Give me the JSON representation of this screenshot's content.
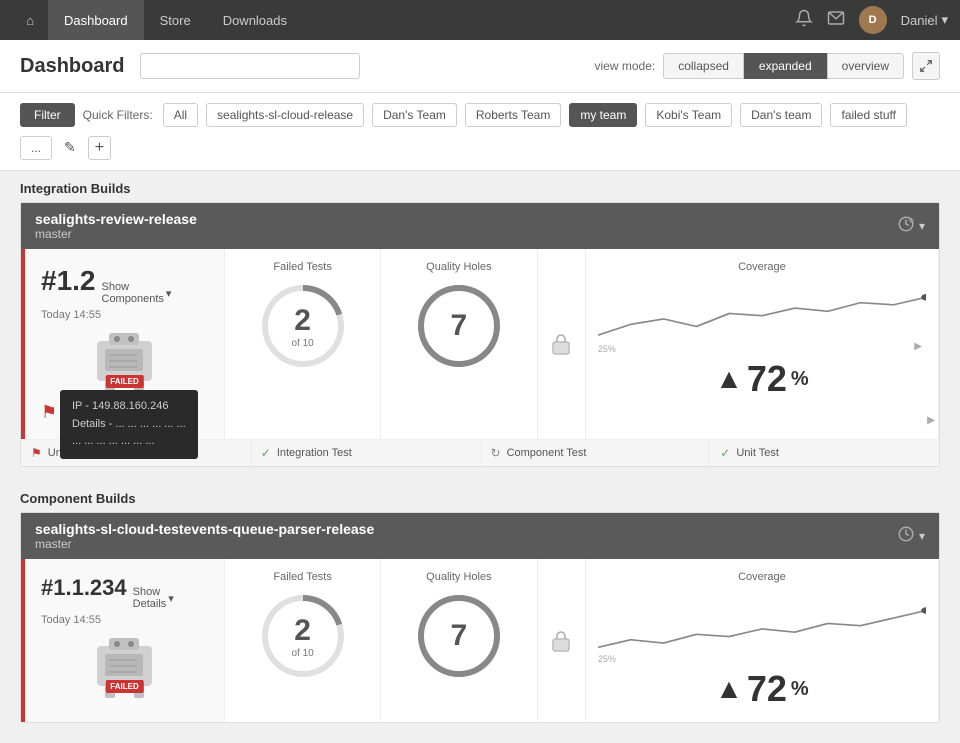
{
  "nav": {
    "home_icon": "⌂",
    "items": [
      {
        "label": "Dashboard",
        "active": true
      },
      {
        "label": "Store",
        "active": false
      },
      {
        "label": "Downloads",
        "active": false
      }
    ],
    "notification_icon": "🔔",
    "mail_icon": "✉",
    "user_name": "Daniel",
    "dropdown_icon": "▾"
  },
  "header": {
    "title": "Dashboard",
    "search_placeholder": "",
    "view_mode_label": "view mode:",
    "view_buttons": [
      "collapsed",
      "expanded",
      "overview"
    ],
    "active_view": "expanded",
    "expand_icon": "⤢"
  },
  "filter_bar": {
    "filter_btn": "Filter",
    "quick_filters_label": "Quick Filters:",
    "tags": [
      {
        "label": "All",
        "active": false
      },
      {
        "label": "sealights-sl-cloud-release",
        "active": false
      },
      {
        "label": "Dan's Team",
        "active": false
      },
      {
        "label": "Roberts Team",
        "active": false
      },
      {
        "label": "my team",
        "active": true
      },
      {
        "label": "Kobi's Team",
        "active": false
      },
      {
        "label": "Dan's team",
        "active": false
      },
      {
        "label": "failed stuff",
        "active": false
      },
      {
        "label": "...",
        "active": false
      }
    ],
    "edit_icon": "✎",
    "add_icon": "+"
  },
  "section1": {
    "title": "Integration Builds"
  },
  "build1": {
    "title": "sealights-review-release",
    "subtitle": "master",
    "build_number": "#1.2",
    "show_label": "Show",
    "components_label": "Components",
    "date": "Today 14:55",
    "failed_label": "FAILED",
    "failed_tests_label": "Failed Tests",
    "failed_count": "2",
    "failed_of": "of 10",
    "quality_holes_label": "Quality Holes",
    "quality_count": "7",
    "coverage_label": "Coverage",
    "coverage_value": "72",
    "coverage_percent": "%",
    "coverage_25": "25%",
    "test_items": [
      {
        "icon": "🚩",
        "label": "Unit Test",
        "icon_color": "red"
      },
      {
        "icon": "✓",
        "label": "Integration Test",
        "icon_color": "green"
      },
      {
        "icon": "↻",
        "label": "Component Test",
        "icon_color": "spin"
      },
      {
        "icon": "✓",
        "label": "Unit Test",
        "icon_color": "green"
      }
    ]
  },
  "tooltip": {
    "ip_label": "IP -",
    "ip_value": "149.88.160.246",
    "details_label": "Details -",
    "details_value": "... ... ... ... ... ...",
    "line3": "... ... ... ... ... ... ..."
  },
  "section2": {
    "title": "Component Builds"
  },
  "build2": {
    "title": "sealights-sl-cloud-testevents-queue-parser-release",
    "subtitle": "master",
    "build_number": "#1.1.234",
    "show_label": "Show",
    "details_label": "Details",
    "date": "Today 14:55",
    "failed_label": "FAILED",
    "failed_tests_label": "Failed Tests",
    "failed_count": "2",
    "failed_of": "of 10",
    "quality_holes_label": "Quality Holes",
    "quality_count": "7",
    "coverage_label": "Coverage",
    "coverage_value": "72",
    "coverage_percent": "%",
    "coverage_25": "25%"
  }
}
